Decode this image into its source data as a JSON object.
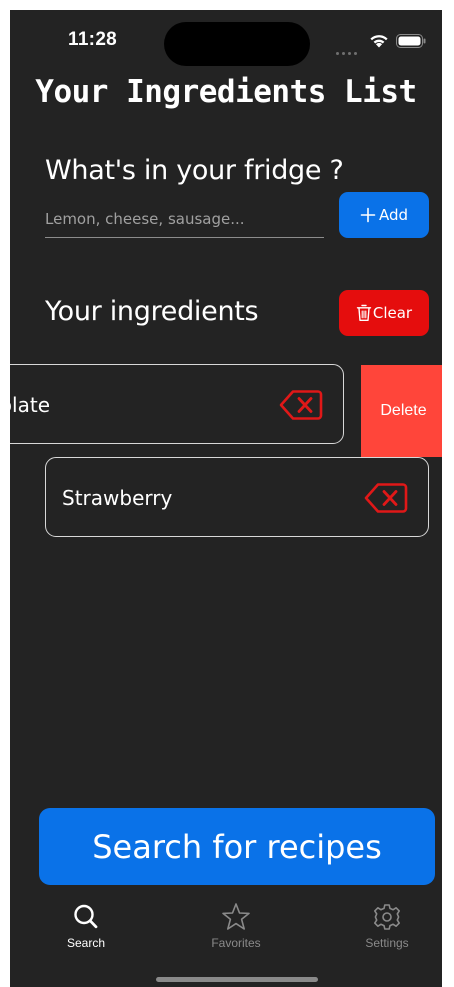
{
  "status_bar": {
    "time": "11:28"
  },
  "header": {
    "title": "Your Ingredients List"
  },
  "add_section": {
    "label": "What's in your fridge ?",
    "input_value": "",
    "input_placeholder": "Lemon, cheese, sausage...",
    "add_button_label": "Add"
  },
  "ingredients_section": {
    "label": "Your ingredients",
    "clear_button_label": "Clear",
    "items": [
      {
        "name": "Chocolate",
        "visible_text": "olate",
        "swiped_open": true
      },
      {
        "name": "Strawberry",
        "visible_text": "Strawberry",
        "swiped_open": false
      }
    ],
    "delete_action_label": "Delete"
  },
  "search_button_label": "Search for recipes",
  "tab_bar": {
    "items": [
      {
        "label": "Search",
        "icon": "magnifier-icon",
        "selected": true
      },
      {
        "label": "Favorites",
        "icon": "star-icon",
        "selected": false
      },
      {
        "label": "Settings",
        "icon": "gear-icon",
        "selected": false
      }
    ]
  },
  "colors": {
    "background": "#232323",
    "accent_blue": "#0A72E8",
    "clear_red": "#E50D0D",
    "delete_red": "#FF453A",
    "remove_icon_red": "#E01818",
    "inactive_tab": "#8A8A8A"
  }
}
